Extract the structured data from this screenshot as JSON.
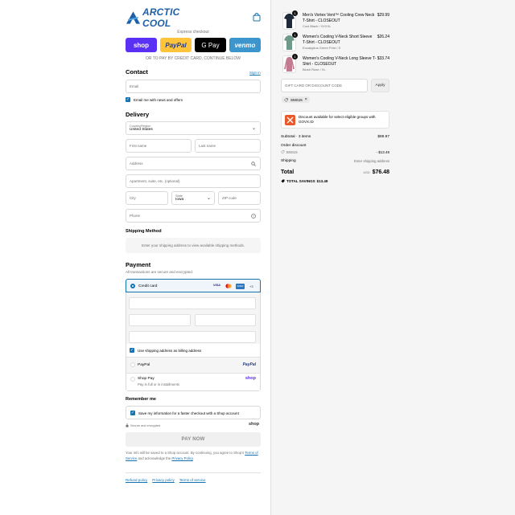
{
  "header": {
    "brand": "ARCTIC COOL",
    "bag_icon": "shopping-bag-icon"
  },
  "express": {
    "title": "Express checkout",
    "buttons": {
      "shop": "shop",
      "paypal": "PayPal",
      "gpay": "G Pay",
      "venmo": "venmo"
    },
    "divider": "OR TO PAY BY CREDIT CARD, CONTINUE BELOW"
  },
  "contact": {
    "title": "Contact",
    "signin": "Sign in",
    "email_placeholder": "Email",
    "news_label": "Email me with news and offers"
  },
  "delivery": {
    "title": "Delivery",
    "country_label": "Country/Region",
    "country_value": "United States",
    "first_name": "First name",
    "last_name": "Last name",
    "address": "Address",
    "apartment": "Apartment, suite, etc. (optional)",
    "city": "City",
    "state_label": "State",
    "state_value": "Iowa",
    "zip": "ZIP code",
    "phone": "Phone"
  },
  "shipping": {
    "title": "Shipping Method",
    "message": "Enter your shipping address to view available shipping methods."
  },
  "payment": {
    "title": "Payment",
    "subtitle": "All transactions are secure and encrypted.",
    "credit_card": "Credit card",
    "card_brands": [
      "VISA",
      "MC",
      "AMEX",
      "+3"
    ],
    "billing_same": "Use shipping address as billing address",
    "paypal": "PayPal",
    "paypal_logo": "PayPal",
    "shop_pay": "Shop Pay",
    "shop_pay_sub": "Pay in full or in installments",
    "shop_logo": "shop"
  },
  "remember": {
    "title": "Remember me",
    "save_label": "Save my information for a faster checkout with a Shop account",
    "secure": "Secure and encrypted",
    "shop_logo": "shop"
  },
  "paynow": "PAY NOW",
  "legal": {
    "before": "Your info will be saved to a Shop account. By continuing, you agree to Shop's",
    "terms": "Terms of Service",
    "middle": "and acknowledge the",
    "privacy": "Privacy Policy",
    "end": "."
  },
  "footer_links": [
    "Refund policy",
    "Privacy policy",
    "Terms of service"
  ],
  "cart": {
    "items": [
      {
        "qty": "1",
        "name": "Men's Vortex Vent™ Cooling Crew Neck T-Shirt - CLOSEOUT",
        "variant": "Cool Black / XXXXL",
        "price": "$29.99",
        "color": "#1e2a3a"
      },
      {
        "qty": "1",
        "name": "Women's Cooling V-Neck Short Sleeve T-Shirt - CLOSEOUT",
        "variant": "Eucalyptus Green Print / S",
        "price": "$26.24",
        "color": "#6f9a8a"
      },
      {
        "qty": "1",
        "name": "Women's Cooling V-Neck Long Sleeve T-Shirt - CLOSEOUT",
        "variant": "Blush Rose / XL",
        "price": "$33.74",
        "color": "#c27a90"
      }
    ],
    "discount_placeholder": "GIFT CARD OR DISCOUNT CODE",
    "apply": "Apply",
    "applied_code": "SMS15",
    "govx_text": "Discount available for select eligible groups with GOVX.ID",
    "subtotal_label": "Subtotal · 3 items",
    "subtotal_value": "$89.97",
    "order_discount_label": "Order discount",
    "discount_code": "SMS15",
    "discount_value": "- $13.49",
    "shipping_label": "Shipping",
    "shipping_value": "Enter shipping address",
    "total_label": "Total",
    "currency": "USD",
    "total_value": "$76.48",
    "savings_label": "TOTAL SAVINGS",
    "savings_value": "$13.49"
  }
}
